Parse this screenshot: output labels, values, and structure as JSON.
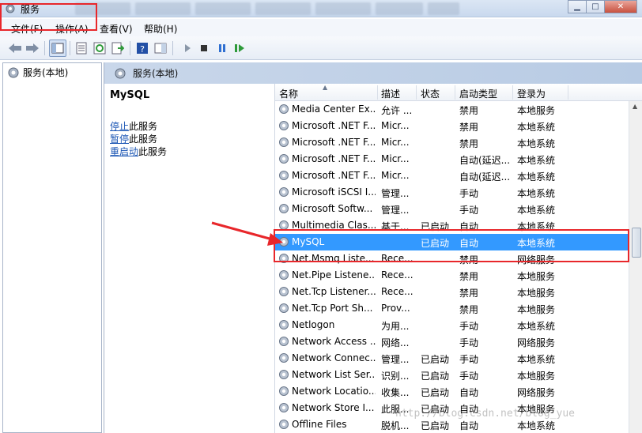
{
  "window": {
    "title": "服务"
  },
  "menu": [
    "文件(F)",
    "操作(A)",
    "查看(V)",
    "帮助(H)"
  ],
  "tree": {
    "item": "服务(本地)"
  },
  "pane": {
    "header": "服务(本地)",
    "selected_service": "MySQL",
    "actions": [
      {
        "link": "停止",
        "rest": "此服务"
      },
      {
        "link": "暂停",
        "rest": "此服务"
      },
      {
        "link": "重启动",
        "rest": "此服务"
      }
    ]
  },
  "columns": {
    "name": "名称",
    "desc": "描述",
    "status": "状态",
    "startup": "启动类型",
    "logon": "登录为"
  },
  "rows": [
    {
      "name": "Media Center Ex...",
      "desc": "允许 ...",
      "status": "",
      "startup": "禁用",
      "logon": "本地服务"
    },
    {
      "name": "Microsoft .NET F...",
      "desc": "Micr...",
      "status": "",
      "startup": "禁用",
      "logon": "本地系统"
    },
    {
      "name": "Microsoft .NET F...",
      "desc": "Micr...",
      "status": "",
      "startup": "禁用",
      "logon": "本地系统"
    },
    {
      "name": "Microsoft .NET F...",
      "desc": "Micr...",
      "status": "",
      "startup": "自动(延迟...",
      "logon": "本地系统"
    },
    {
      "name": "Microsoft .NET F...",
      "desc": "Micr...",
      "status": "",
      "startup": "自动(延迟...",
      "logon": "本地系统"
    },
    {
      "name": "Microsoft iSCSI I...",
      "desc": "管理...",
      "status": "",
      "startup": "手动",
      "logon": "本地系统"
    },
    {
      "name": "Microsoft Softw...",
      "desc": "管理...",
      "status": "",
      "startup": "手动",
      "logon": "本地系统"
    },
    {
      "name": "Multimedia Clas...",
      "desc": "基于...",
      "status": "已启动",
      "startup": "自动",
      "logon": "本地系统"
    },
    {
      "name": "MySQL",
      "desc": "",
      "status": "已启动",
      "startup": "自动",
      "logon": "本地系统"
    },
    {
      "name": "Net.Msmq Liste...",
      "desc": "Rece...",
      "status": "",
      "startup": "禁用",
      "logon": "网络服务"
    },
    {
      "name": "Net.Pipe Listene...",
      "desc": "Rece...",
      "status": "",
      "startup": "禁用",
      "logon": "本地服务"
    },
    {
      "name": "Net.Tcp Listener...",
      "desc": "Rece...",
      "status": "",
      "startup": "禁用",
      "logon": "本地服务"
    },
    {
      "name": "Net.Tcp Port Sh...",
      "desc": "Prov...",
      "status": "",
      "startup": "禁用",
      "logon": "本地服务"
    },
    {
      "name": "Netlogon",
      "desc": "为用...",
      "status": "",
      "startup": "手动",
      "logon": "本地系统"
    },
    {
      "name": "Network Access ...",
      "desc": "网络...",
      "status": "",
      "startup": "手动",
      "logon": "网络服务"
    },
    {
      "name": "Network Connec...",
      "desc": "管理...",
      "status": "已启动",
      "startup": "手动",
      "logon": "本地系统"
    },
    {
      "name": "Network List Ser...",
      "desc": "识别...",
      "status": "已启动",
      "startup": "手动",
      "logon": "本地服务"
    },
    {
      "name": "Network Locatio...",
      "desc": "收集...",
      "status": "已启动",
      "startup": "自动",
      "logon": "网络服务"
    },
    {
      "name": "Network Store I...",
      "desc": "此服...",
      "status": "已启动",
      "startup": "自动",
      "logon": "本地服务"
    },
    {
      "name": "Offline Files",
      "desc": "脱机...",
      "status": "已启动",
      "startup": "自动",
      "logon": "本地系统"
    }
  ],
  "selected_row_index": 8,
  "watermark": "http://blog.csdn.net/blog_yue",
  "colors": {
    "selection": "#3399ff",
    "annotation": "#e8272b",
    "link": "#1a55b4"
  }
}
